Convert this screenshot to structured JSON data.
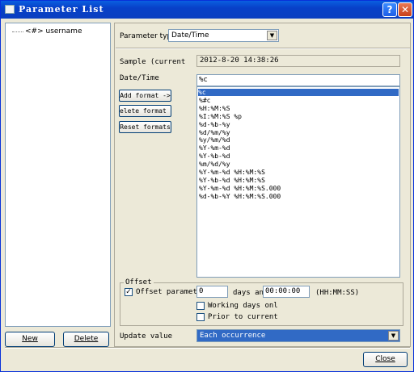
{
  "window": {
    "title": "Parameter List",
    "help_label": "?",
    "close_label": "✕"
  },
  "tree": {
    "items": [
      {
        "label": "<#> username"
      }
    ]
  },
  "left_buttons": {
    "new": "New",
    "delete": "Delete"
  },
  "param_type": {
    "label": "Parameter type:",
    "value": "Date/Time"
  },
  "sample": {
    "label": "Sample (current",
    "value": "2012-8-20 14:38:26"
  },
  "datetime": {
    "label": "Date/Time",
    "value": "%c"
  },
  "format_buttons": {
    "add": "Add format ->",
    "delete": "elete format <",
    "reset": "Reset formats"
  },
  "formats": [
    "%c",
    "%#c",
    "%H:%M:%S",
    "%I:%M:%S %p",
    "%d-%b-%y",
    "%d/%m/%y",
    "%y/%m/%d",
    "%Y-%m-%d",
    "%Y-%b-%d",
    "%m/%d/%y",
    "%Y-%m-%d %H:%M:%S",
    "%Y-%b-%d %H:%M:%S",
    "%Y-%m-%d %H:%M:%S.000",
    "%d-%b-%Y %H:%M:%S.000"
  ],
  "selected_format_index": 0,
  "offset": {
    "group_label": "Offset",
    "checkbox_label": "Offset parameter",
    "checked": true,
    "days": "0",
    "days_label": "days and",
    "time": "00:00:00",
    "time_hint": "(HH:MM:SS)",
    "working_days": "Working days onl",
    "prior": "Prior to current"
  },
  "update": {
    "label": "Update value",
    "value": "Each occurrence"
  },
  "footer": {
    "close": "Close"
  }
}
